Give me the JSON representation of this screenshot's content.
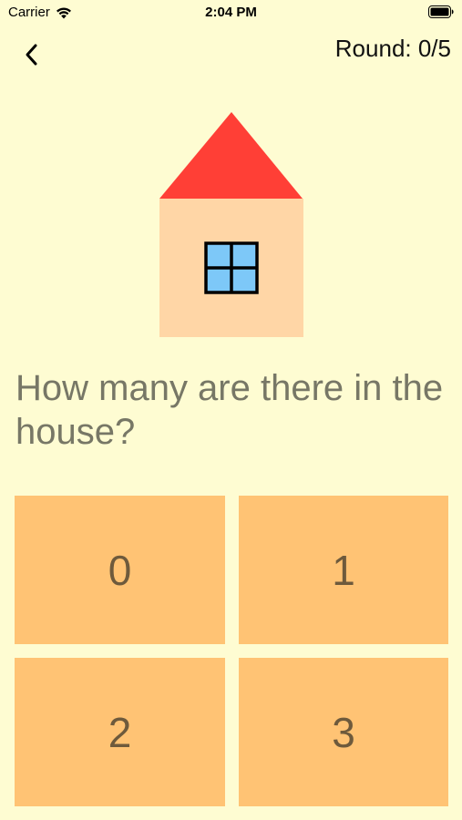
{
  "status_bar": {
    "carrier": "Carrier",
    "time": "2:04 PM"
  },
  "header": {
    "round_label": "Round: 0/5"
  },
  "illustration": {
    "roof_color": "#FF3F36",
    "wall_color": "#FFD6A6",
    "window_color": "#7DC8F8"
  },
  "question": {
    "text": "How many are there in the house?"
  },
  "answers": [
    {
      "label": "0"
    },
    {
      "label": "1"
    },
    {
      "label": "2"
    },
    {
      "label": "3"
    }
  ],
  "colors": {
    "background": "#FEFCD2",
    "answer_button": "#FFC374",
    "answer_text": "#6E5A3C",
    "question_text": "#777766"
  }
}
